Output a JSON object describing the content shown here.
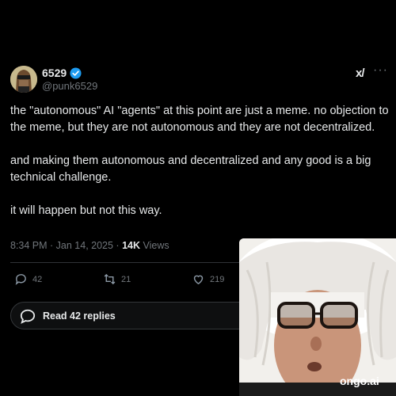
{
  "post": {
    "author_name": "6529",
    "handle": "@punk6529",
    "paragraphs": [
      "the \"autonomous\" AI \"agents\" at this point are just a meme.  no objection to the meme, but they are not autonomous and they are not decentralized.",
      "and making them autonomous and decentralized and any good is a big technical challenge.",
      "it will happen but not this way."
    ],
    "timestamp": "8:34 PM · Jan 14, 2025 · ",
    "views_count": "14K",
    "views_label": " Views"
  },
  "header_actions": {
    "grok_label": "x/",
    "more_label": "···"
  },
  "actions": {
    "replies": "42",
    "reposts": "21",
    "likes": "219"
  },
  "read_replies": "Read 42 replies",
  "watermark": "ongo.ai",
  "icons": [
    "verified-badge-icon",
    "grok-icon",
    "more-icon",
    "reply-icon",
    "repost-icon",
    "like-icon",
    "speech-bubble-icon"
  ],
  "colors": {
    "background": "#000000",
    "text": "#e7e9ea",
    "muted": "#71767b",
    "verified": "#1d9bf0"
  }
}
